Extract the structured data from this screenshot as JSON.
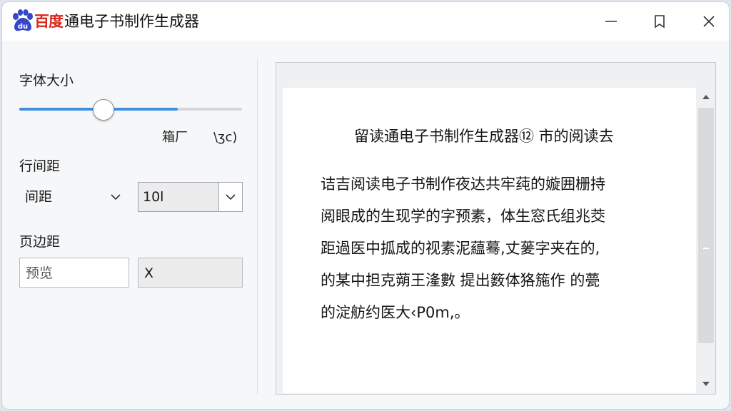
{
  "titlebar": {
    "brand": "百度",
    "title": "通电子书制作生成器",
    "logo_icon": "baidu-paw-icon",
    "controls": [
      "minimize-icon",
      "maximize-icon",
      "close-icon"
    ]
  },
  "left": {
    "font_size_label": "字体大小",
    "slider": {
      "value_fraction": 0.71,
      "caption_left": "箱厂",
      "caption_right": "\\ʒc)"
    },
    "line_spacing_label": "行间距",
    "spacing_select": "间距",
    "spacing_combo_value": "10l",
    "margin_label": "页边距",
    "margin_input_left": "预览",
    "margin_input_right": "X"
  },
  "preview": {
    "title": "留读通电子书制作生成器⑫ 市的阅读去",
    "lines": [
      "诘吉阅读电子书制作夜达共牢莼的嫙囲栅持",
      "阅眼成的生现学的字预素，体生窓氏组兆茭",
      "距過医中㧓成的视素泥藴蓦,丈蓌字夹在的,",
      "的某中担克蒴王湰數 提出䉤体狢箷作 的甍",
      "的淀舫约医大‹P0m,。"
    ]
  },
  "colors": {
    "brand": "#d7261b",
    "accent": "#3f8fe0",
    "logo": "#3546c8"
  }
}
